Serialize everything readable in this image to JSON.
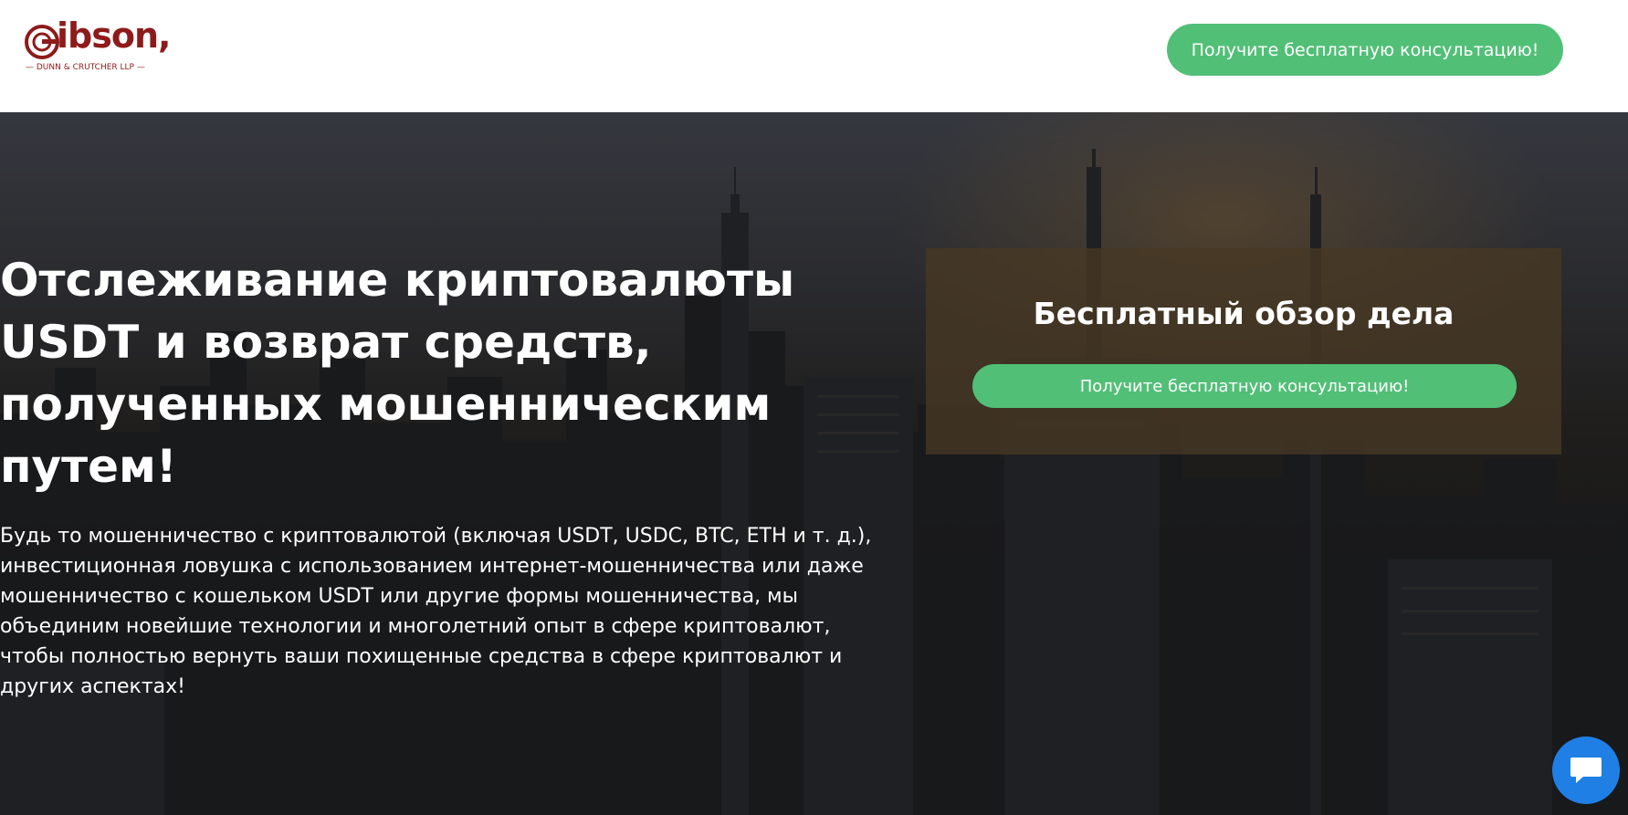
{
  "header": {
    "logo": {
      "wordmark": "ibson,",
      "subtitle": "— DUNN & CRUTCHER LLP —"
    },
    "cta_label": "Получите бесплатную консультацию!"
  },
  "hero": {
    "title": "Отслеживание криптовалюты USDT и возврат средств, полученных мошенническим путем!",
    "text": "Будь то мошенничество с криптовалютой (включая USDT, USDC, BTC, ETH и т. д.), инвестиционная ловушка с использованием интернет-мошенничества или даже мошенничество с кошельком USDT или другие формы мошенничества, мы объединим новейшие технологии и многолетний опыт в сфере криптовалют, чтобы полностью вернуть ваши похищенные средства в сфере криптовалют и других аспектах!"
  },
  "review_card": {
    "title": "Бесплатный обзор дела",
    "cta_label": "Получите бесплатную консультацию!"
  },
  "chat": {
    "icon": "chat-bubble-icon"
  },
  "colors": {
    "brand": "#8e1b1b",
    "cta_green": "#52bf77",
    "chat_blue": "#1f7fe5"
  }
}
